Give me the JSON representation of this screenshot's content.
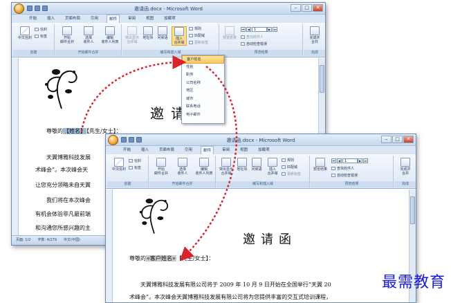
{
  "brand_text": "最需教育",
  "back_window": {
    "title": "邀请函.docx - Microsoft Word",
    "tabs": [
      "开始",
      "插入",
      "页面布局",
      "引用",
      "邮件",
      "审阅",
      "视图",
      "加载项"
    ],
    "active_tab": "邮件",
    "ribbon": {
      "create_group": "创建",
      "chinese_envelope": "中文信封",
      "envelope": "信封",
      "label": "标签",
      "start_merge_group": "开始邮件合并",
      "start_merge": "开始\n邮件合并",
      "select_recipients": "选择\n收件人",
      "edit_recipients": "编辑\n收件人列表",
      "write_group": "编写和插入域",
      "highlight_fields": "突出显示\n合并域",
      "address_block": "地址块",
      "greeting_line": "问候语",
      "insert_merge_field": "插入\n合并域",
      "rules": "规则",
      "match_fields": "匹配域",
      "update_labels": "更新标签",
      "preview_group": "预览结果",
      "preview_results": "预览结果",
      "record_number": "1",
      "find_recipient": "查找收件人",
      "auto_check": "自动检查错误",
      "finish_group": "完成",
      "finish_merge": "完成并\n合并"
    },
    "merge_field_dropdown": [
      "客户姓名",
      "性别",
      "职务",
      "公司名称",
      "地区",
      "城市",
      "联系电话",
      "电子邮件"
    ],
    "selected_field": "客户姓名",
    "doc": {
      "title": "邀请函",
      "greeting_prefix": "尊敬的",
      "field_name": "【姓名】",
      "field_title": "【先生/女士】",
      "colon": "：",
      "line1": "天翼博雅科技发展",
      "line2": "术峰会”。本次峰会天",
      "line3": "让您充分领略未自天翼",
      "line4": "我们将在本次峰会",
      "line5": "有机会体验非凡最前端",
      "line6": "和沟通您所感兴趣的主"
    },
    "status": [
      "页面: 1/2",
      "字数: 4/279",
      "中文(中国)"
    ]
  },
  "front_window": {
    "title": "邀请函.docx - Microsoft Word",
    "doc": {
      "title": "邀请函",
      "greeting_prefix": "尊敬的",
      "merge_field": "«客户姓名»",
      "field_title": "【先生/女士】",
      "colon": "：",
      "line1": "天翼博雅科技发展有限公司将于 2009 年 10 月 9 日开始在全国举行“天翼 20",
      "line2": "术峰会”。本次峰会天翼博雅科技发展有限公司将为您提供丰富的交互式培训课程，"
    }
  },
  "colors": {
    "arrow": "#d9232d",
    "brand": "#1b1bd6",
    "field_highlight": "#9fb8d6"
  }
}
